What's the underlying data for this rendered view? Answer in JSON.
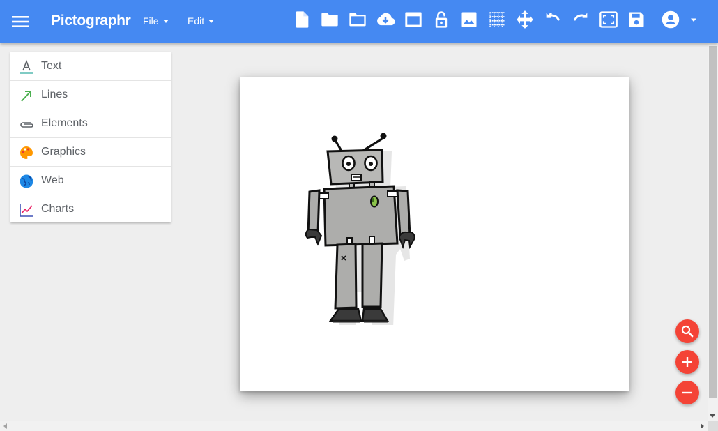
{
  "app": {
    "title": "Pictographr",
    "accent_color": "#4589f2",
    "background_color": "#eeeeee"
  },
  "menus": [
    {
      "label": "File"
    },
    {
      "label": "Edit"
    }
  ],
  "toolbar": {
    "icons": [
      "new-page-icon",
      "folder-open-icon",
      "folder-outline-icon",
      "cloud-download-icon",
      "window-icon",
      "lock-open-icon",
      "image-icon",
      "grid-icon",
      "move-icon",
      "undo-icon",
      "redo-icon",
      "fit-screen-icon",
      "save-icon",
      "account-icon"
    ]
  },
  "sidebar": {
    "items": [
      {
        "label": "Text",
        "icon": "text-format-icon"
      },
      {
        "label": "Lines",
        "icon": "arrow-line-icon"
      },
      {
        "label": "Elements",
        "icon": "paperclip-icon"
      },
      {
        "label": "Graphics",
        "icon": "palette-icon"
      },
      {
        "label": "Web",
        "icon": "globe-icon"
      },
      {
        "label": "Charts",
        "icon": "line-chart-icon"
      }
    ]
  },
  "canvas": {
    "content": "robot-illustration"
  },
  "fabs": {
    "color": "#f44336",
    "icons": [
      "zoom-search-icon",
      "zoom-in-plus-icon",
      "zoom-out-minus-icon"
    ]
  }
}
